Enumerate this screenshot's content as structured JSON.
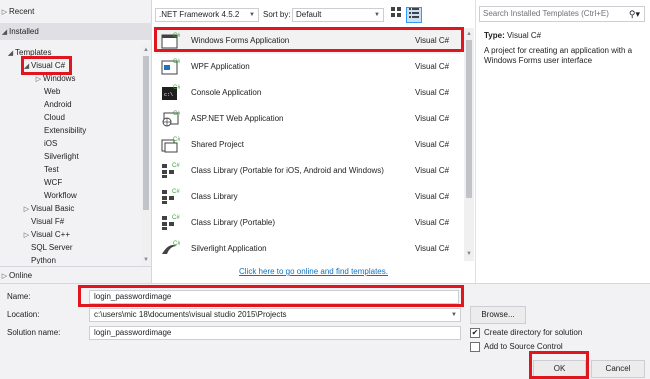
{
  "sidebar": {
    "recent": "Recent",
    "installed": "Installed",
    "online": "Online",
    "tree": [
      {
        "label": "Templates",
        "twisty": "◢"
      },
      {
        "label": "Visual C#",
        "twisty": "◢"
      },
      {
        "label": "Windows",
        "twisty": "▷"
      },
      {
        "label": "Web",
        "twisty": ""
      },
      {
        "label": "Android",
        "twisty": ""
      },
      {
        "label": "Cloud",
        "twisty": ""
      },
      {
        "label": "Extensibility",
        "twisty": ""
      },
      {
        "label": "iOS",
        "twisty": ""
      },
      {
        "label": "Silverlight",
        "twisty": ""
      },
      {
        "label": "Test",
        "twisty": ""
      },
      {
        "label": "WCF",
        "twisty": ""
      },
      {
        "label": "Workflow",
        "twisty": ""
      },
      {
        "label": "Visual Basic",
        "twisty": "▷"
      },
      {
        "label": "Visual F#",
        "twisty": ""
      },
      {
        "label": "Visual C++",
        "twisty": "▷"
      },
      {
        "label": "SQL Server",
        "twisty": ""
      },
      {
        "label": "Python",
        "twisty": ""
      }
    ]
  },
  "toolbar": {
    "framework": ".NET Framework 4.5.2",
    "sort_label": "Sort by:",
    "sort_value": "Default"
  },
  "templates": [
    {
      "name": "Windows Forms Application",
      "lang": "Visual C#",
      "icon": "winforms-icon"
    },
    {
      "name": "WPF Application",
      "lang": "Visual C#",
      "icon": "wpf-icon"
    },
    {
      "name": "Console Application",
      "lang": "Visual C#",
      "icon": "console-icon"
    },
    {
      "name": "ASP.NET Web Application",
      "lang": "Visual C#",
      "icon": "web-app-icon"
    },
    {
      "name": "Shared Project",
      "lang": "Visual C#",
      "icon": "shared-project-icon"
    },
    {
      "name": "Class Library (Portable for iOS, Android and Windows)",
      "lang": "Visual C#",
      "icon": "class-library-icon"
    },
    {
      "name": "Class Library",
      "lang": "Visual C#",
      "icon": "class-library-icon"
    },
    {
      "name": "Class Library (Portable)",
      "lang": "Visual C#",
      "icon": "class-library-icon"
    },
    {
      "name": "Silverlight Application",
      "lang": "Visual C#",
      "icon": "silverlight-icon"
    }
  ],
  "online_link": "Click here to go online and find templates.",
  "details": {
    "search_placeholder": "Search Installed Templates (Ctrl+E)",
    "type_label": "Type:",
    "type_value": "Visual C#",
    "description": "A project for creating an application with a Windows Forms user interface"
  },
  "form": {
    "name_label": "Name:",
    "name_value": "login_passwordimage",
    "location_label": "Location:",
    "location_value": "c:\\users\\mic 18\\documents\\visual studio 2015\\Projects",
    "solution_label": "Solution name:",
    "solution_value": "login_passwordimage",
    "browse": "Browse...",
    "create_dir": "Create directory for solution",
    "create_dir_checked": "✔",
    "source_control": "Add to Source Control",
    "ok": "OK",
    "cancel": "Cancel"
  },
  "colors": {
    "highlight": "#e0161f",
    "link": "#0e70c0",
    "accent_green": "#3c9f3c"
  }
}
